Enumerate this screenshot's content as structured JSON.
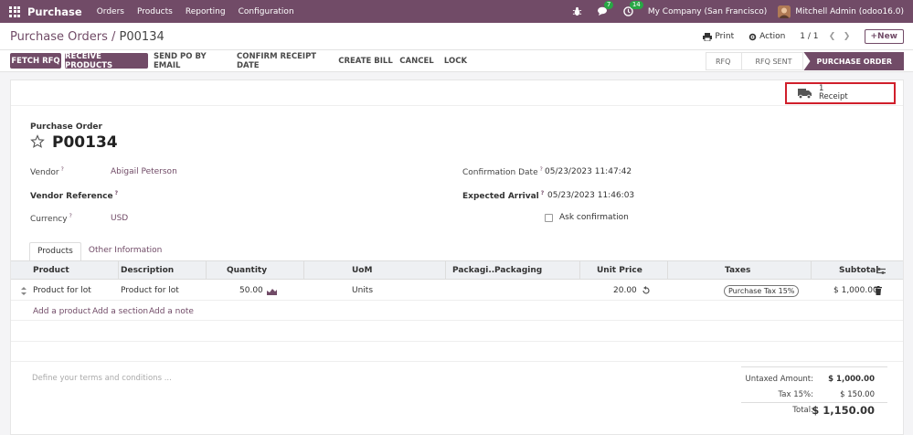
{
  "topnav": {
    "brand": "Purchase",
    "menu": [
      "Orders",
      "Products",
      "Reporting",
      "Configuration"
    ],
    "chat_count": "7",
    "activity_count": "14",
    "company": "My Company (San Francisco)",
    "user": "Mitchell Admin (odoo16.0)"
  },
  "control": {
    "breadcrumb_parent": "Purchase Orders",
    "breadcrumb_sep": " / ",
    "breadcrumb_current": "P00134",
    "print_label": "Print",
    "action_label": "Action",
    "pager": "1 / 1",
    "new_label": "New"
  },
  "statusbar": {
    "buttons": [
      "FETCH RFQ",
      "RECEIVE PRODUCTS",
      "SEND PO BY EMAIL",
      "CONFIRM RECEIPT DATE",
      "CREATE BILL",
      "CANCEL",
      "LOCK"
    ],
    "stages": [
      "RFQ",
      "RFQ SENT",
      "PURCHASE ORDER"
    ]
  },
  "smart_button": {
    "count": "1",
    "label": "Receipt"
  },
  "form": {
    "heading_small": "Purchase Order",
    "name": "P00134",
    "vendor_label": "Vendor",
    "vendor_value": "Abigail Peterson",
    "vendor_ref_label": "Vendor Reference",
    "currency_label": "Currency",
    "currency_value": "USD",
    "confirmation_label": "Confirmation Date",
    "confirmation_value": "05/23/2023 11:47:42",
    "arrival_label": "Expected Arrival",
    "arrival_value": "05/23/2023 11:46:03",
    "ask_confirmation_label": "Ask confirmation",
    "help_mark": "?"
  },
  "tabs": [
    "Products",
    "Other Information"
  ],
  "table": {
    "headers": [
      "Product",
      "Description",
      "Quantity",
      "UoM",
      "Packagi...",
      "Packaging",
      "Unit Price",
      "Taxes",
      "Subtotal"
    ],
    "row": {
      "product": "Product for lot",
      "description": "Product for lot",
      "quantity": "50.00",
      "uom": "Units",
      "unit_price": "20.00",
      "taxes": "Purchase Tax 15%",
      "subtotal": "$ 1,000.00"
    },
    "add_product": "Add a product",
    "add_section": "Add a section",
    "add_note": "Add a note"
  },
  "terms_placeholder": "Define your terms and conditions ...",
  "totals": {
    "untaxed_label": "Untaxed Amount:",
    "untaxed_value": "$ 1,000.00",
    "tax_label": "Tax 15%:",
    "tax_value": "$ 150.00",
    "total_label": "Total:",
    "total_value": "$ 1,150.00"
  },
  "colors": {
    "brand": "#714b67",
    "highlight": "#d01f2b",
    "badge": "#28a745"
  }
}
